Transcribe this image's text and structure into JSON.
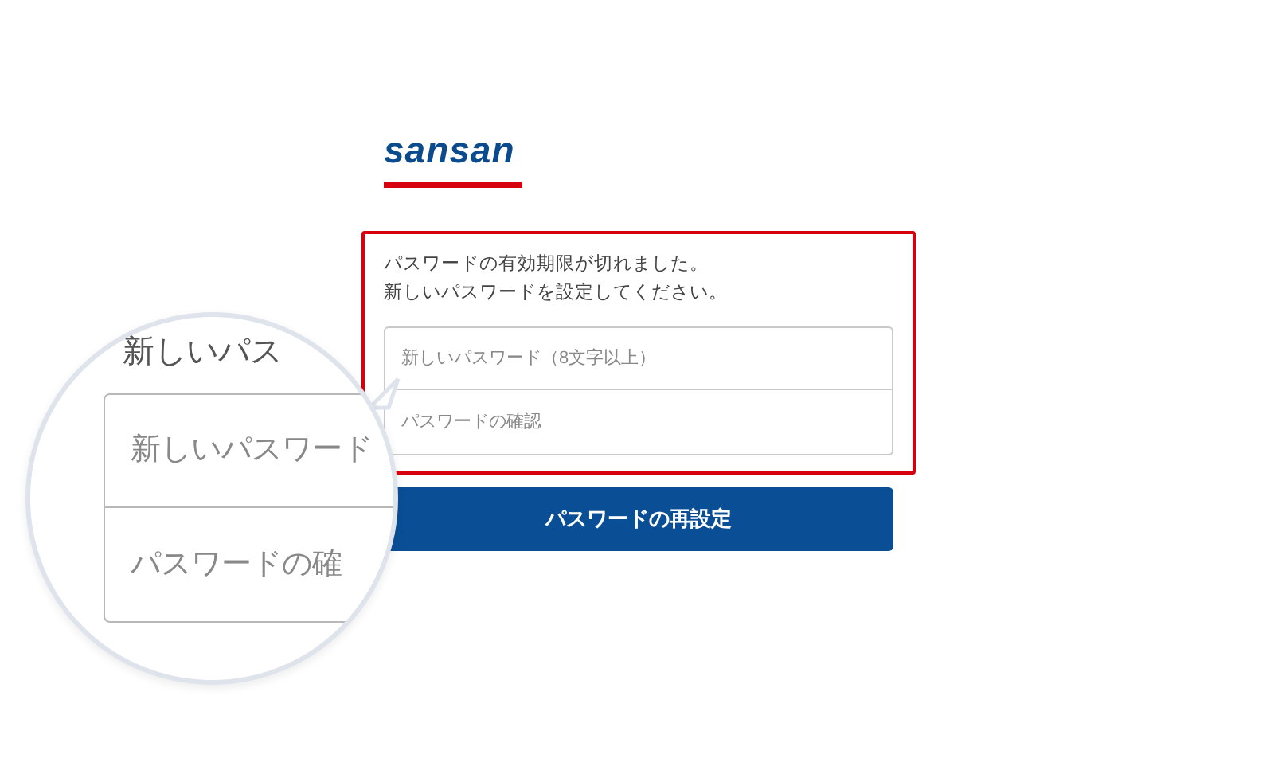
{
  "logo": {
    "text": "sansan"
  },
  "notice": {
    "lines": [
      "パスワードの有効期限が切れました。",
      "新しいパスワードを設定してください。"
    ]
  },
  "fields": [
    {
      "placeholder": "新しいパスワード（8文字以上）"
    },
    {
      "placeholder": "パスワードの確認"
    }
  ],
  "submit_button": {
    "label": "パスワードの再設定"
  },
  "magnifier": {
    "caption": "新しいパス",
    "fields": [
      {
        "placeholder": "新しいパスワード"
      },
      {
        "placeholder": "パスワードの確"
      }
    ]
  }
}
